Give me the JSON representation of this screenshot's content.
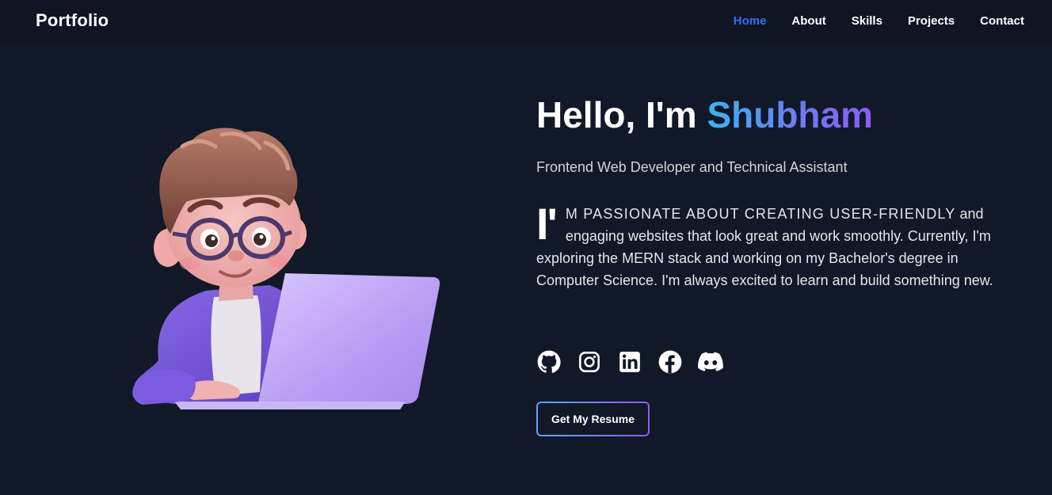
{
  "nav": {
    "brand": "Portfolio",
    "links": [
      {
        "label": "Home",
        "active": true
      },
      {
        "label": "About"
      },
      {
        "label": "Skills"
      },
      {
        "label": "Projects"
      },
      {
        "label": "Contact"
      }
    ]
  },
  "hero": {
    "greeting_prefix": "Hello, I'm",
    "name": "Shubham",
    "subtitle": "Frontend Web Developer and Technical Assistant",
    "bio_dropcap": "I'",
    "bio_caps": "M PASSIONATE ABOUT CREATING USER-FRIENDLY",
    "bio_rest": "and engaging websites that look great and work smoothly. Currently, I'm exploring the MERN stack and working on my Bachelor's degree in Computer Science. I'm always excited to learn and build something new.",
    "resume_label": "Get My Resume"
  },
  "socials": [
    {
      "icon": "github-icon"
    },
    {
      "icon": "instagram-icon"
    },
    {
      "icon": "linkedin-icon"
    },
    {
      "icon": "facebook-icon"
    },
    {
      "icon": "discord-icon"
    }
  ],
  "colors": {
    "background": "#111827",
    "active_link": "#3b6cf6",
    "name_gradient_start": "#38b6f2",
    "name_gradient_end": "#8b5cf6"
  }
}
